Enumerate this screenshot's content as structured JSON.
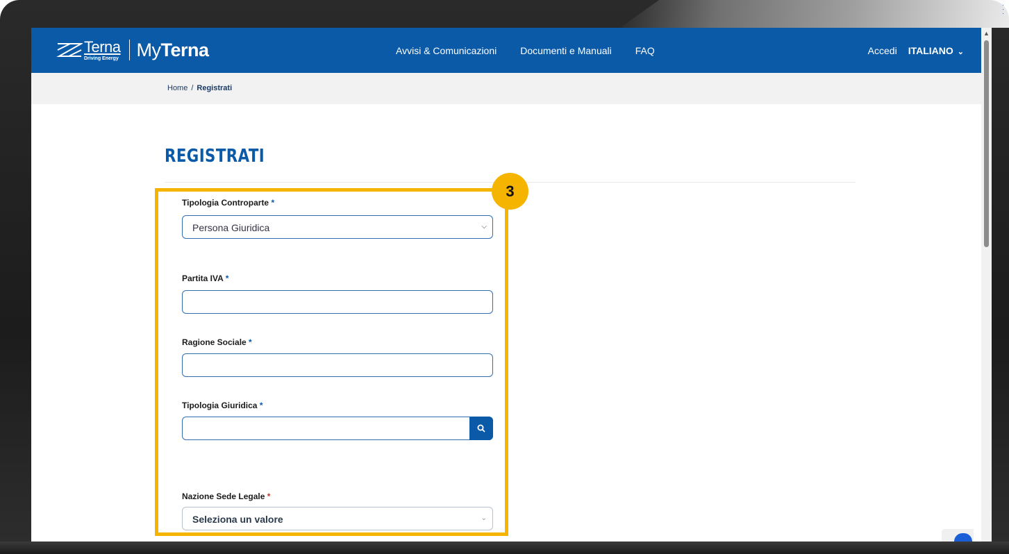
{
  "header": {
    "logo_terna": "Terna",
    "logo_tagline": "Driving Energy",
    "logo_my": "My",
    "logo_my_brand": "Terna",
    "nav": [
      "Avvisi & Comunicazioni",
      "Documenti e Manuali",
      "FAQ"
    ],
    "login": "Accedi",
    "language": "ITALIANO"
  },
  "breadcrumb": {
    "home": "Home",
    "separator": "/",
    "current": "Registrati"
  },
  "page": {
    "title": "REGISTRATI"
  },
  "form": {
    "tipologia_controparte": {
      "label": "Tipologia Controparte",
      "required": "*",
      "value": "Persona Giuridica"
    },
    "partita_iva": {
      "label": "Partita IVA",
      "required": "*",
      "value": ""
    },
    "ragione_sociale": {
      "label": "Ragione Sociale",
      "required": "*",
      "value": ""
    },
    "tipologia_giuridica": {
      "label": "Tipologia Giuridica",
      "required": "*",
      "value": ""
    },
    "nazione_sede_legale": {
      "label": "Nazione Sede Legale",
      "required": "*",
      "placeholder": "Seleziona un valore"
    }
  },
  "annotation": {
    "step": "3",
    "color": "#f4b400"
  },
  "colors": {
    "brand": "#0a5aa8",
    "highlight": "#f4b400"
  },
  "icons": [
    "terna-logo-icon",
    "chevron-down-icon",
    "search-icon",
    "scroll-up-icon",
    "recaptcha-icon"
  ]
}
